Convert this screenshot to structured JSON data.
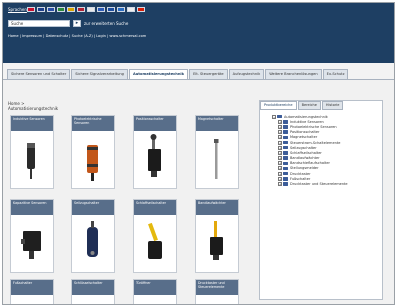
{
  "header": {
    "language_label": "Sprachen",
    "flags": [
      {
        "name": "flag-de",
        "color": "#c8102e"
      },
      {
        "name": "flag-gb",
        "color": "#1d3f8c"
      },
      {
        "name": "flag-fr",
        "color": "#2b4fa8"
      },
      {
        "name": "flag-it",
        "color": "#2c8a3a"
      },
      {
        "name": "flag-es",
        "color": "#d9a400"
      },
      {
        "name": "flag-nl",
        "color": "#b22234"
      },
      {
        "name": "flag-pl",
        "color": "#e8e8e8"
      },
      {
        "name": "flag-ru",
        "color": "#2d5cb8"
      },
      {
        "name": "flag-cz",
        "color": "#1d4ea0"
      },
      {
        "name": "flag-se",
        "color": "#2a6cc1"
      },
      {
        "name": "flag-jp",
        "color": "#eeeeee"
      },
      {
        "name": "flag-cn",
        "color": "#d81e06"
      }
    ],
    "search_value": "Suche",
    "search_go_icon": "▸",
    "extended_search": "zur erweiterten Suche",
    "breadcrumb": "Home | Impressum | Datenschutz | Suche (A-Z) | Login | www.schmersal.com"
  },
  "tabs": [
    {
      "label": "Sichere Sensoren und Schalter",
      "active": false
    },
    {
      "label": "Sichere Signalverarbeitung",
      "active": false
    },
    {
      "label": "Automatisierungstechnik",
      "active": true
    },
    {
      "label": "Elt. Steuergeräte",
      "active": false
    },
    {
      "label": "Aufzugstechnik",
      "active": false
    },
    {
      "label": "Weitere Branchenlösungen",
      "active": false
    },
    {
      "label": "Ex-Schutz",
      "active": false
    }
  ],
  "category": {
    "line1": "Home >",
    "line2": "Automatisierungstechnik"
  },
  "products": [
    {
      "label": "Induktive Sensoren",
      "device": "cylinder-sensor"
    },
    {
      "label": "Photoelektrische Sensoren",
      "device": "photo-sensor"
    },
    {
      "label": "Positionsschalter",
      "device": "position-switch"
    },
    {
      "label": "Magnetschalter",
      "device": "magnetic-switch"
    },
    {
      "label": "Kapazitive Sensoren",
      "device": "box-sensor"
    },
    {
      "label": "Seilzugschalter",
      "device": "rope-switch"
    },
    {
      "label": "Schlaffseilschalter",
      "device": "slack-switch"
    },
    {
      "label": "Bandlaufwächter",
      "device": "belt-switch"
    },
    {
      "label": "Fußschalter",
      "device": "none"
    },
    {
      "label": "Schlüsselschalter",
      "device": "none"
    },
    {
      "label": "Türöffner",
      "device": "none"
    },
    {
      "label": "Drucktaster und Steuerelemente",
      "device": "none"
    }
  ],
  "sidebar": {
    "tabs": [
      {
        "label": "Produktbereiche",
        "active": true
      },
      {
        "label": "Bereiche",
        "active": false
      },
      {
        "label": "Historie",
        "active": false
      }
    ],
    "tree": [
      {
        "label": "Automatisierungstechnik",
        "level": 0
      },
      {
        "label": "Induktive Sensoren",
        "level": 1
      },
      {
        "label": "Photoelektrische Sensoren",
        "level": 1
      },
      {
        "label": "Positionsschalter",
        "level": 1
      },
      {
        "label": "Magnetschalter",
        "level": 1
      },
      {
        "label": "Steuerstrom-Schaltelemente",
        "level": 1
      },
      {
        "label": "Seilzugschalter",
        "level": 1
      },
      {
        "label": "Schlaffseilschalter",
        "level": 1
      },
      {
        "label": "Bandlaufwächter",
        "level": 1
      },
      {
        "label": "Bandschieflaufschalter",
        "level": 1
      },
      {
        "label": "Stellungsmelder",
        "level": 1
      },
      {
        "label": "Drucktaster",
        "level": 1
      },
      {
        "label": "Fußschalter",
        "level": 1
      },
      {
        "label": "Drucktaster und Steuerelemente",
        "level": 1
      }
    ]
  },
  "colors": {
    "header": "#1e3f63",
    "card_header": "#586e8a",
    "accent": "#1e3f63"
  }
}
